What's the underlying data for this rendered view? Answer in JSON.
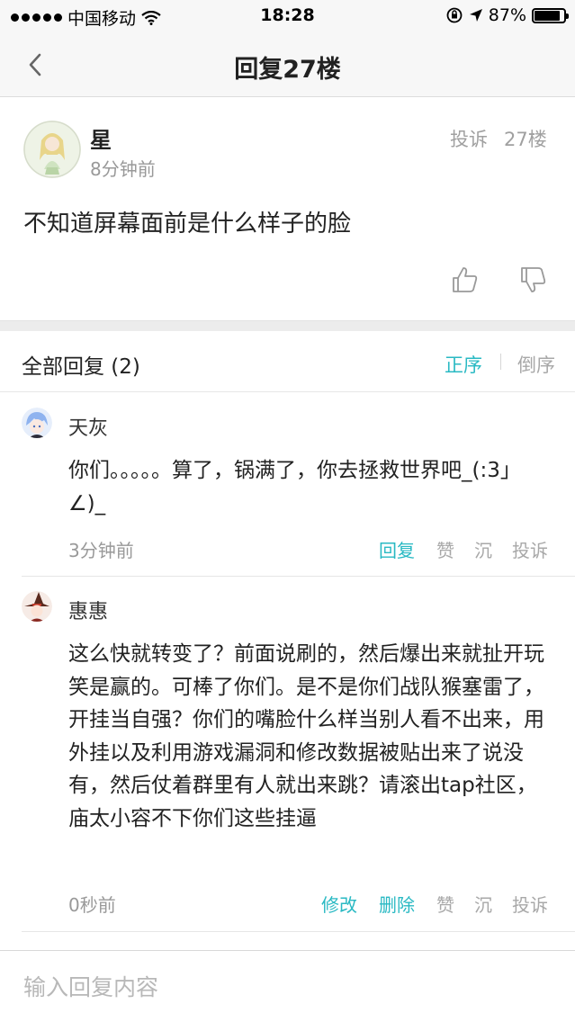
{
  "status_bar": {
    "carrier": "中国移动",
    "time": "18:28",
    "battery": "87%",
    "battery_level": 0.87,
    "icons": [
      "signal-dots-icon",
      "wifi-icon",
      "orientation-lock-icon",
      "location-arrow-icon",
      "battery-icon"
    ]
  },
  "nav": {
    "title": "回复27楼",
    "back_icon": "chevron-left-icon"
  },
  "post": {
    "username": "星",
    "time": "8分钟前",
    "report_label": "投诉",
    "floor": "27楼",
    "content": "不知道屏幕面前是什么样子的脸",
    "like_icon": "thumbs-up-icon",
    "dislike_icon": "thumbs-down-icon"
  },
  "replies_header": {
    "title": "全部回复 (2)",
    "sort_asc": "正序",
    "sort_desc": "倒序",
    "accent_color": "#29b9c3"
  },
  "replies": [
    {
      "username": "天灰",
      "content": "你们。。。。。算了，锅满了，你去拯救世界吧_(:3」∠)_",
      "time": "3分钟前",
      "actions": [
        "回复",
        "赞",
        "沉",
        "投诉"
      ]
    },
    {
      "username": "惠惠",
      "content": "这么快就转变了？前面说刷的，然后爆出来就扯开玩笑是赢的。可棒了你们。是不是你们战队猴塞雷了，开挂当自强？你们的嘴脸什么样当别人看不出来，用外挂以及利用游戏漏洞和修改数据被贴出来了说没有，然后仗着群里有人就出来跳？请滚出tap社区，庙太小容不下你们这些挂逼",
      "time": "0秒前",
      "actions": [
        "修改",
        "删除",
        "赞",
        "沉",
        "投诉"
      ]
    }
  ],
  "input": {
    "placeholder": "输入回复内容",
    "value": ""
  }
}
